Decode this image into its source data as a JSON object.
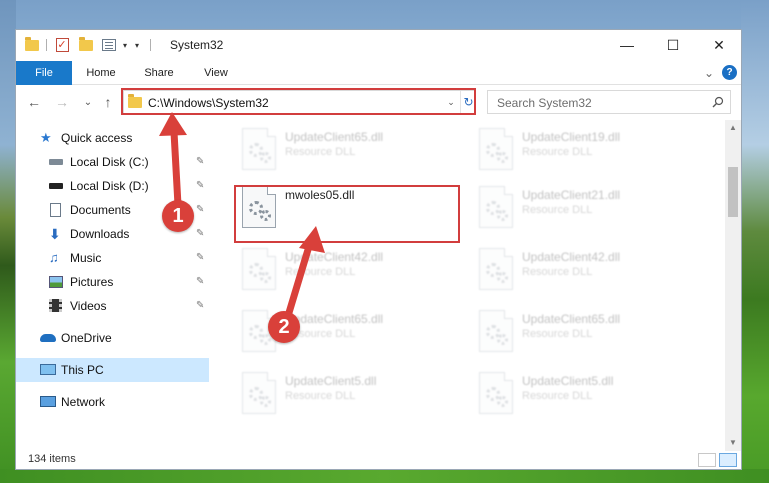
{
  "window": {
    "title": "System32",
    "minimize_glyph": "—",
    "maximize_glyph": "☐",
    "close_glyph": "✕"
  },
  "ribbon": {
    "tabs": [
      "File",
      "Home",
      "Share",
      "View"
    ],
    "collapse_glyph": "⌄",
    "help_glyph": "?"
  },
  "navigation": {
    "back_glyph": "←",
    "forward_glyph": "→",
    "recent_glyph": "⌄",
    "up_glyph": "↑",
    "address": "C:\\Windows\\System32",
    "address_dropdown_glyph": "⌄",
    "refresh_glyph": "↻",
    "search_placeholder": "Search System32"
  },
  "sidebar": {
    "items": [
      {
        "label": "Quick access",
        "icon": "star-icon",
        "pinned": false
      },
      {
        "label": "Local Disk (C:)",
        "icon": "drive-icon",
        "pinned": true
      },
      {
        "label": "Local Disk (D:)",
        "icon": "drive-icon",
        "pinned": true
      },
      {
        "label": "Documents",
        "icon": "documents-icon",
        "pinned": true
      },
      {
        "label": "Downloads",
        "icon": "download-icon",
        "pinned": true
      },
      {
        "label": "Music",
        "icon": "music-icon",
        "pinned": true
      },
      {
        "label": "Pictures",
        "icon": "pictures-icon",
        "pinned": true
      },
      {
        "label": "Videos",
        "icon": "videos-icon",
        "pinned": true
      },
      {
        "label": "OneDrive",
        "icon": "cloud-icon",
        "pinned": false
      },
      {
        "label": "This PC",
        "icon": "computer-icon",
        "pinned": false,
        "selected": true
      },
      {
        "label": "Network",
        "icon": "network-icon",
        "pinned": false
      }
    ],
    "pin_glyph": "📌"
  },
  "files": [
    {
      "name": "UpdateClient65.dll",
      "type": "Resource DLL",
      "faded": true
    },
    {
      "name": "UpdateClient19.dll",
      "type": "Resource DLL",
      "faded": true
    },
    {
      "name": "mwoles05.dll",
      "type": "",
      "faded": false,
      "highlighted": true
    },
    {
      "name": "UpdateClient21.dll",
      "type": "Resource DLL",
      "faded": true
    },
    {
      "name": "UpdateClient42.dll",
      "type": "Resource DLL",
      "faded": true
    },
    {
      "name": "UpdateClient42.dll",
      "type": "Resource DLL",
      "faded": true
    },
    {
      "name": "UpdateClient65.dll",
      "type": "Resource DLL",
      "faded": true
    },
    {
      "name": "UpdateClient65.dll",
      "type": "Resource DLL",
      "faded": true
    },
    {
      "name": "UpdateClient5.dll",
      "type": "Resource DLL",
      "faded": true
    },
    {
      "name": "UpdateClient5.dll",
      "type": "Resource DLL",
      "faded": true
    }
  ],
  "scrollbar": {
    "up_glyph": "▲",
    "down_glyph": "▼"
  },
  "status": {
    "item_count": "134 items"
  },
  "callouts": [
    "1",
    "2"
  ],
  "colors": {
    "accent": "#1979ca",
    "highlight_red": "#d23d3d",
    "callout_red": "#d9403a",
    "selected_bg": "#cce8ff"
  }
}
